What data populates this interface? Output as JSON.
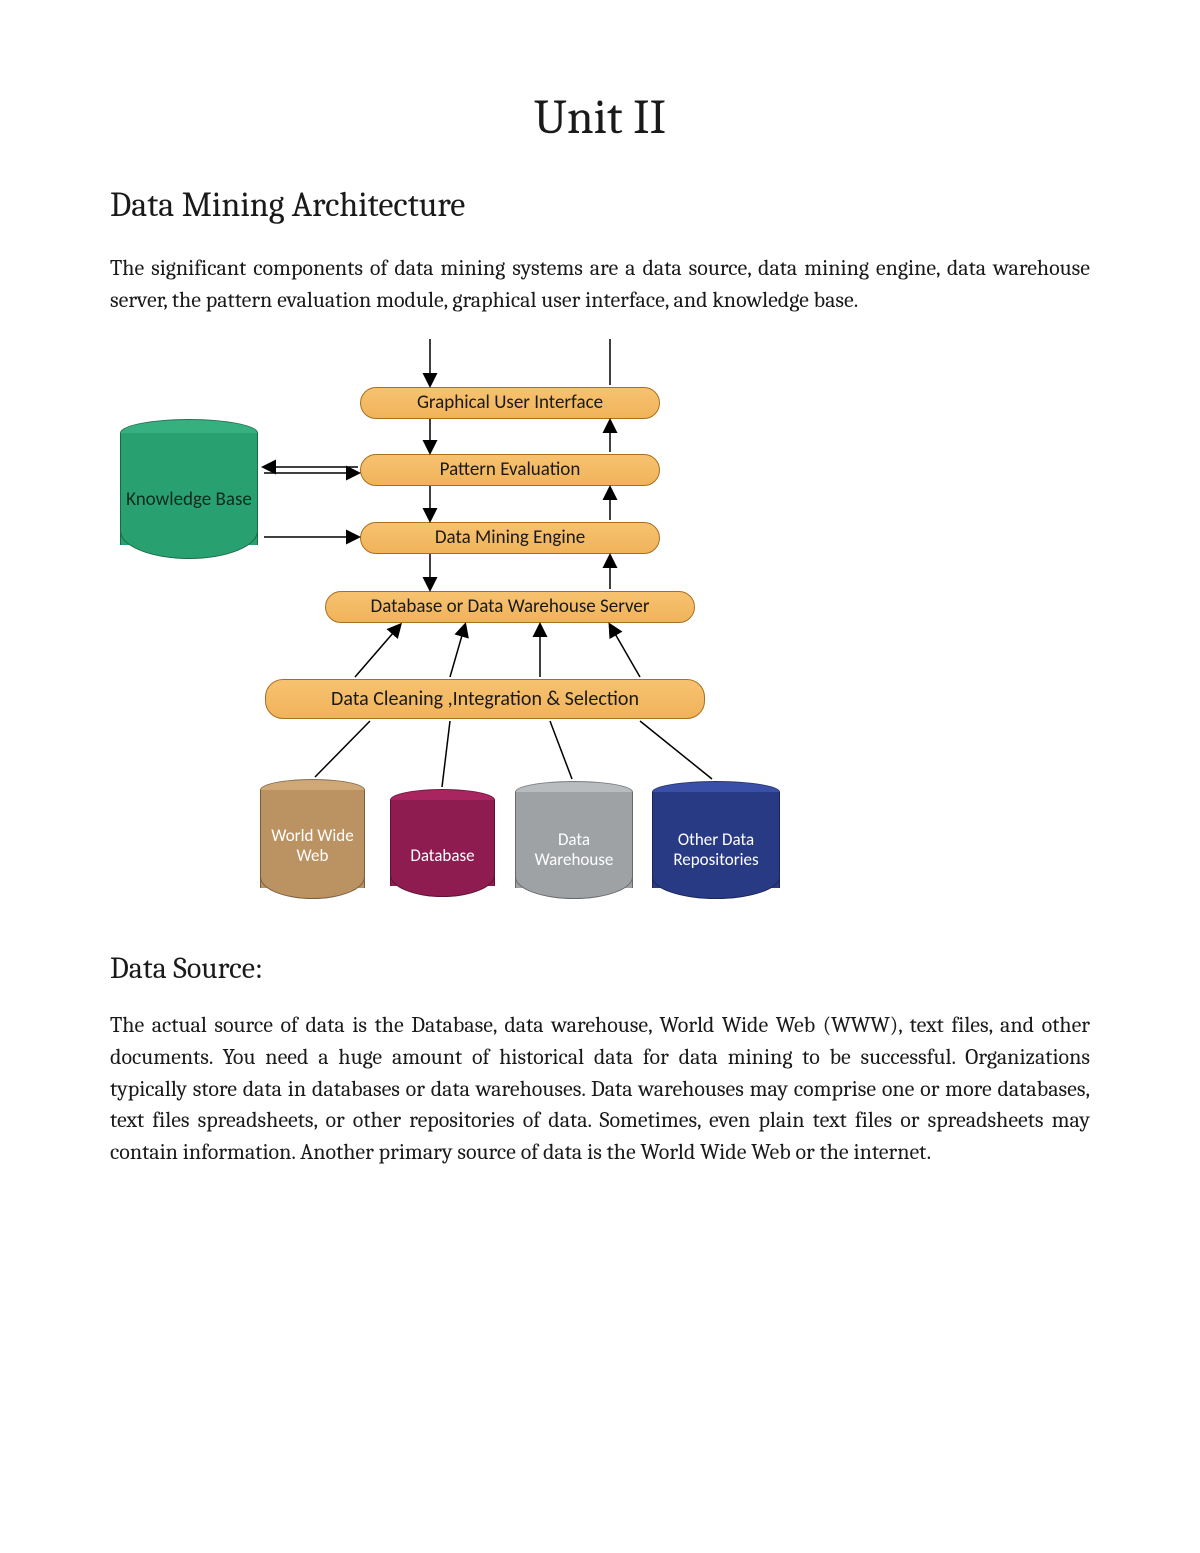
{
  "page": {
    "title": "Unit II",
    "heading": "Data Mining Architecture",
    "intro": "The significant components of data mining systems are a data source, data mining engine, data warehouse server, the pattern evaluation module, graphical user interface, and knowledge base.",
    "subheading": "Data Source:",
    "body_data_source": "The actual source of data is the Database, data warehouse, World Wide Web (WWW), text files, and other documents. You need a huge amount of historical data for data mining to be successful. Organizations typically store data in databases or data warehouses. Data warehouses may comprise one or more databases, text files spreadsheets, or other repositories of data. Sometimes, even plain text files or spreadsheets may contain information. Another primary source of data is the World Wide Web or the internet."
  },
  "diagram": {
    "knowledge_base": "Knowledge Base",
    "layers": {
      "gui": "Graphical User Interface",
      "pattern": "Pattern Evaluation",
      "engine": "Data Mining Engine",
      "dbserver": "Database or Data Warehouse Server",
      "cleaning": "Data Cleaning ,Integration & Selection"
    },
    "sources": {
      "www": "World Wide Web",
      "database": "Database",
      "warehouse": "Data Warehouse",
      "other": "Other Data Repositories"
    },
    "colors": {
      "knowledge_base": {
        "top": "#36b07f",
        "body": "#29a06f"
      },
      "www": {
        "top": "#cfa877",
        "body": "#bb9261"
      },
      "database": {
        "top": "#a9255f",
        "body": "#8f1c50"
      },
      "warehouse": {
        "top": "#b8bcbf",
        "body": "#9ea2a5"
      },
      "other": {
        "top": "#3a50a8",
        "body": "#283a84"
      }
    }
  }
}
